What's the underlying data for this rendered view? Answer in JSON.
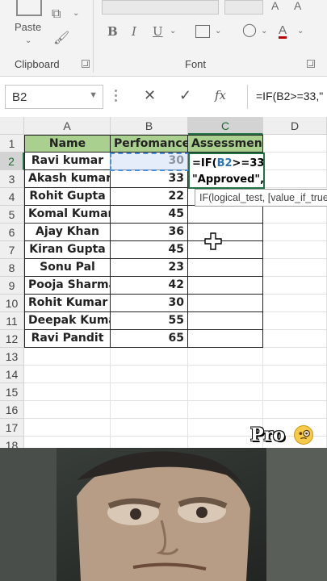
{
  "ribbon": {
    "paste_label": "Paste",
    "clipboard_label": "Clipboard",
    "font_label": "Font",
    "bold_label": "B",
    "italic_label": "I",
    "underline_label": "U",
    "font_color_label": "A"
  },
  "formula_bar": {
    "name_box": "B2",
    "formula": "=IF(B2>=33,\""
  },
  "columns": [
    "A",
    "B",
    "C",
    "D"
  ],
  "rows": [
    "1",
    "2",
    "3",
    "4",
    "5",
    "6",
    "7",
    "8",
    "9",
    "10",
    "11",
    "12",
    "13",
    "14",
    "15",
    "16",
    "17",
    "18"
  ],
  "table": {
    "headers": {
      "name": "Name",
      "performance": "Perfomance",
      "assessment": "Assessment"
    },
    "records": [
      {
        "name": "Ravi kumar",
        "score": "30"
      },
      {
        "name": "Akash kumar",
        "score": "33"
      },
      {
        "name": "Rohit Gupta",
        "score": "22"
      },
      {
        "name": "Komal Kumari",
        "score": "45"
      },
      {
        "name": "Ajay Khan",
        "score": "36"
      },
      {
        "name": "Kiran Gupta",
        "score": "45"
      },
      {
        "name": "Sonu Pal",
        "score": "23"
      },
      {
        "name": "Pooja Sharma",
        "score": "42"
      },
      {
        "name": "Rohit Kumar",
        "score": "30"
      },
      {
        "name": "Deepak Kumar",
        "score": "55"
      },
      {
        "name": "Ravi Pandit",
        "score": "65"
      }
    ]
  },
  "editor": {
    "line1_prefix": "=IF(",
    "line1_ref": "B2",
    "line1_suffix": ">=33,",
    "line2": "\"Approved\","
  },
  "tooltip": "IF(logical_test, [value_if_true], [value_if_false])",
  "overlay": {
    "pro_text": "Pro"
  },
  "colors": {
    "header_fill": "#a9d08e",
    "selection": "#217346",
    "ref_blue": "#2e75b6"
  }
}
